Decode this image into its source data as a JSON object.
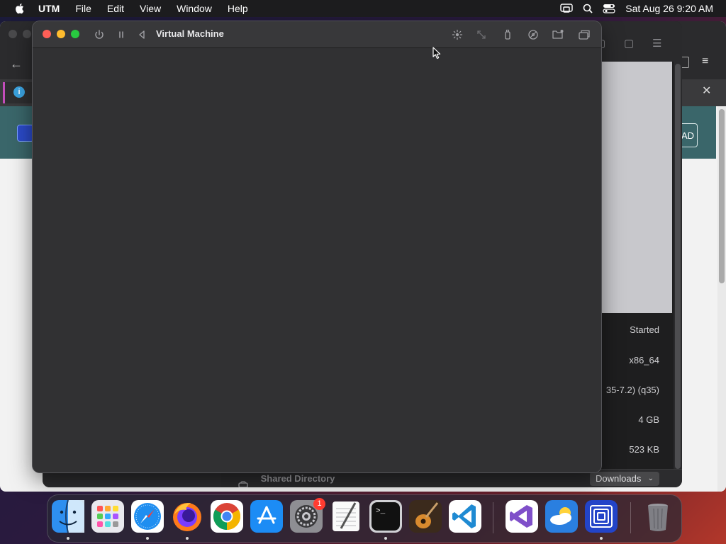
{
  "menubar": {
    "app_name": "UTM",
    "menus": [
      "File",
      "Edit",
      "View",
      "Window",
      "Help"
    ],
    "clock": "Sat Aug 26  9:20 AM"
  },
  "vm_window": {
    "title": "Virtual Machine"
  },
  "utm_window": {
    "info": {
      "status": "Started",
      "architecture": "x86_64",
      "machine": "35-7.2) (q35)",
      "memory": "4 GB",
      "size": "523 KB"
    },
    "shared_directory_label": "Shared Directory",
    "shared_directory_value": "Downloads"
  },
  "browser": {
    "partial_button_text": "AD"
  },
  "dock": {
    "settings_badge": "1",
    "apps": [
      "Finder",
      "Launchpad",
      "Safari",
      "Firefox",
      "Chrome",
      "App Store",
      "System Settings",
      "TextEdit",
      "Terminal",
      "GarageBand",
      "Visual Studio Code",
      "Visual Studio",
      "Weather",
      "UTM",
      "Trash"
    ]
  }
}
